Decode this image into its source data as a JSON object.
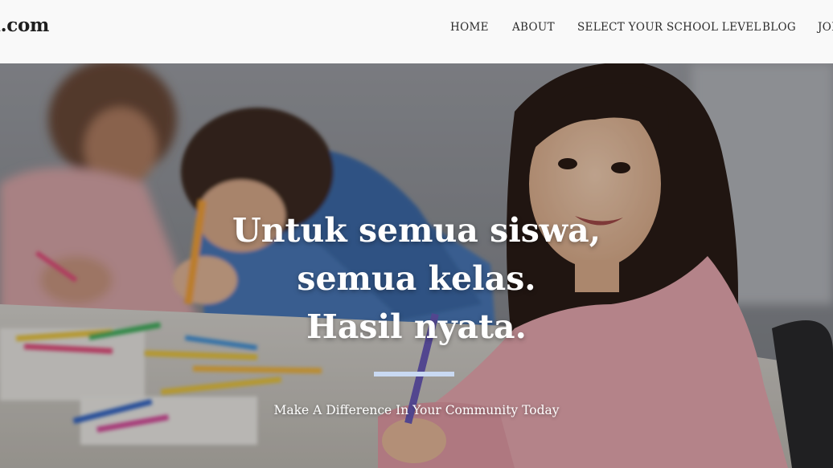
{
  "header": {
    "logo_text": "a.com",
    "nav": [
      {
        "label": "HOME"
      },
      {
        "label": "ABOUT"
      },
      {
        "label": "SELECT YOUR SCHOOL LEVEL"
      },
      {
        "label": "BLOG"
      },
      {
        "label": "JOI"
      }
    ]
  },
  "hero": {
    "heading_lines": [
      "Untuk semua siswa,",
      "semua kelas.",
      "Hasil nyata."
    ],
    "subtitle": "Make A Difference In Your Community Today",
    "divider_color": "#c9d9f2",
    "image": "children-drawing-in-classroom-photo"
  },
  "colors": {
    "header_bg": "#f9f9f9",
    "nav_text": "#2b2b2b",
    "hero_text": "#ffffff"
  }
}
